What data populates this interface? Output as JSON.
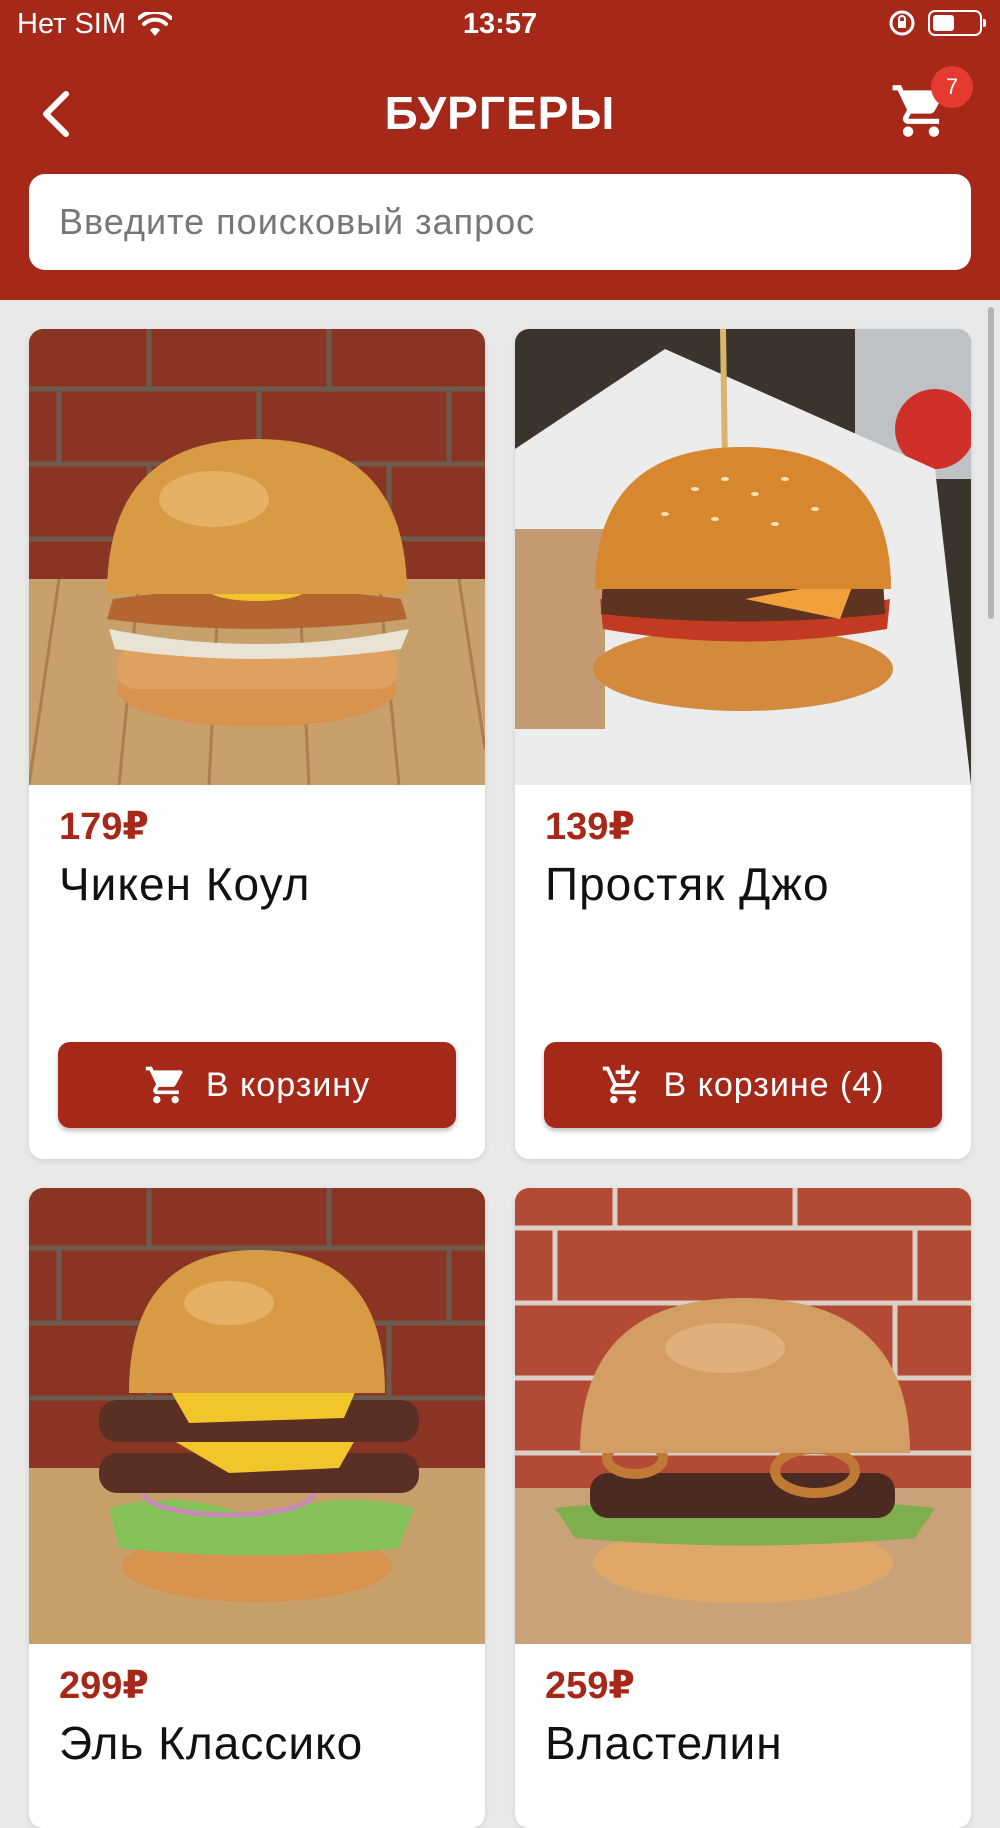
{
  "status_bar": {
    "carrier": "Нет SIM",
    "time": "13:57"
  },
  "header": {
    "title": "БУРГЕРЫ",
    "cart_count": "7"
  },
  "search": {
    "placeholder": "Введите поисковый запрос"
  },
  "products": [
    {
      "price": "179₽",
      "name": "Чикен Коул",
      "button_label": "В корзину",
      "button_icon": "cart-icon"
    },
    {
      "price": "139₽",
      "name": "Простяк Джо",
      "button_label": "В корзине (4)",
      "button_icon": "cart-plus-icon"
    },
    {
      "price": "299₽",
      "name": "Эль Классико"
    },
    {
      "price": "259₽",
      "name": "Властелин"
    }
  ],
  "colors": {
    "brand": "#a52819",
    "badge": "#e53a2f",
    "background": "#e9e9e9"
  }
}
